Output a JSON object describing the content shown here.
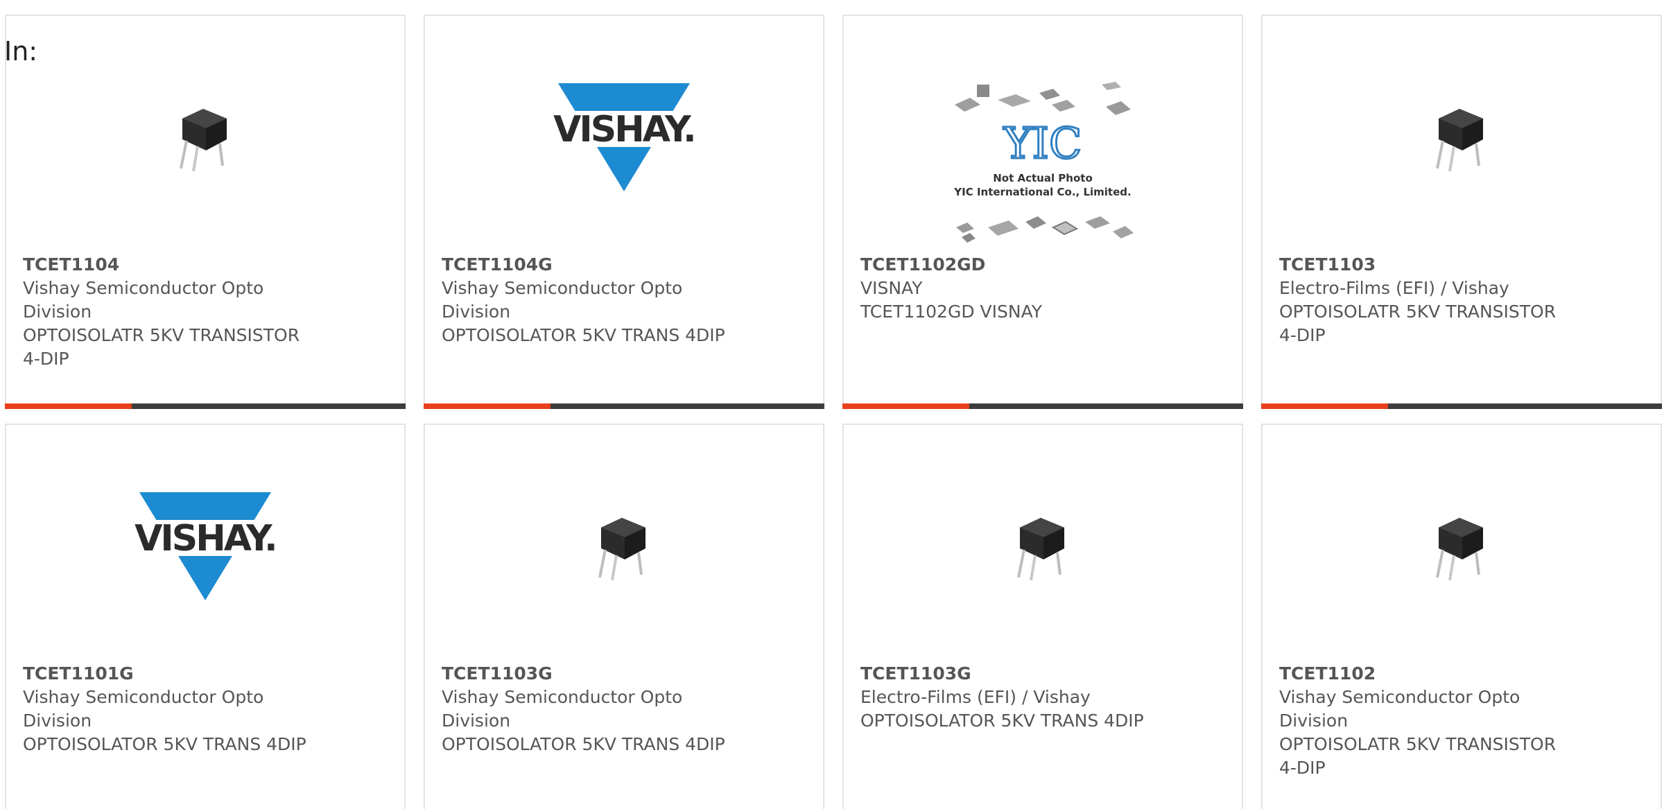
{
  "filter": {
    "label": "In:"
  },
  "colors": {
    "accent": "#e8401c",
    "bar": "#3d3d3d",
    "text": "#555555",
    "vishay_blue": "#1d8bd1"
  },
  "products": [
    {
      "part_number": "TCET1104",
      "manufacturer": "Vishay Semiconductor Opto Division",
      "description": "OPTOISOLATR 5KV TRANSISTOR 4-DIP",
      "image": "optocoupler-dip-icon"
    },
    {
      "part_number": "TCET1104G",
      "manufacturer": "Vishay Semiconductor Opto Division",
      "description": "OPTOISOLATOR 5KV TRANS 4DIP",
      "image": "vishay-logo",
      "image_text": "VISHAY."
    },
    {
      "part_number": "TCET1102GD",
      "manufacturer": "VISNAY",
      "description": "TCET1102GD VISNAY",
      "image": "yic-placeholder",
      "image_text_logo": "YIC",
      "image_text_line1": "Not Actual Photo",
      "image_text_line2": "YIC International Co., Limited."
    },
    {
      "part_number": "TCET1103",
      "manufacturer": "Electro-Films (EFI) / Vishay",
      "description": "OPTOISOLATR 5KV TRANSISTOR 4-DIP",
      "image": "optocoupler-dip-icon"
    },
    {
      "part_number": "TCET1101G",
      "manufacturer": "Vishay Semiconductor Opto Division",
      "description": "OPTOISOLATOR 5KV TRANS 4DIP",
      "image": "vishay-logo",
      "image_text": "VISHAY."
    },
    {
      "part_number": "TCET1103G",
      "manufacturer": "Vishay Semiconductor Opto Division",
      "description": "OPTOISOLATOR 5KV TRANS 4DIP",
      "image": "optocoupler-dip-icon"
    },
    {
      "part_number": "TCET1103G",
      "manufacturer": "Electro-Films (EFI) / Vishay",
      "description": "OPTOISOLATOR 5KV TRANS 4DIP",
      "image": "optocoupler-dip-icon"
    },
    {
      "part_number": "TCET1102",
      "manufacturer": "Vishay Semiconductor Opto Division",
      "description": "OPTOISOLATR 5KV TRANSISTOR 4-DIP",
      "image": "optocoupler-dip-icon"
    }
  ]
}
